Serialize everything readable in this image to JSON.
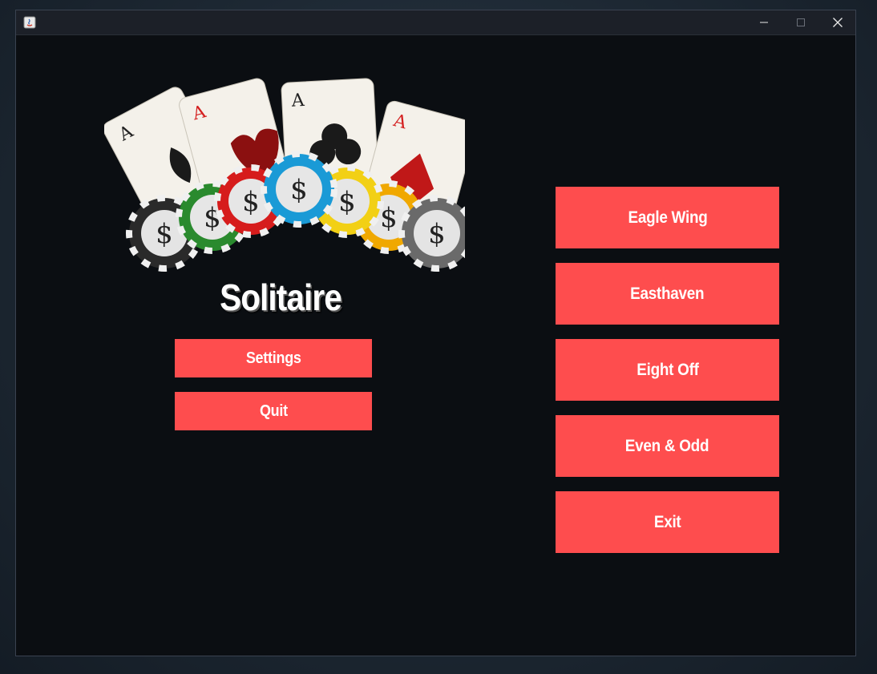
{
  "window": {
    "controls": {
      "minimize_icon": "minimize-icon",
      "maximize_icon": "maximize-icon",
      "close_icon": "close-icon"
    }
  },
  "app": {
    "title": "Solitaire",
    "logo_icon": "cards-and-chips-logo"
  },
  "left_menu": {
    "settings_label": "Settings",
    "quit_label": "Quit"
  },
  "game_menu": {
    "items": [
      {
        "label": "Eagle Wing"
      },
      {
        "label": "Easthaven"
      },
      {
        "label": "Eight Off"
      },
      {
        "label": "Even & Odd"
      },
      {
        "label": "Exit"
      }
    ]
  },
  "colors": {
    "button": "#fe4d4e",
    "background": "#0b0e12",
    "titlebar": "#1c2028"
  }
}
